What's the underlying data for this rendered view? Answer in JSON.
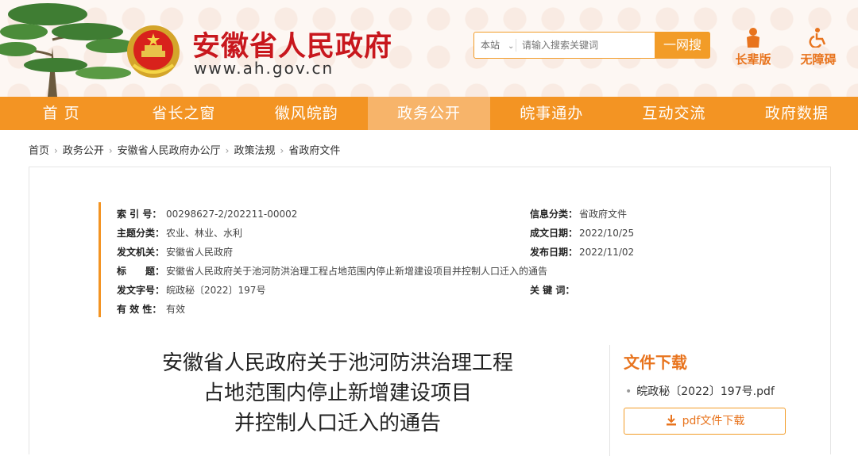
{
  "header": {
    "title": "安徽省人民政府",
    "url": "www.ah.gov.cn",
    "search": {
      "scope": "本站",
      "placeholder": "请输入搜索关键词",
      "button": "一网搜"
    },
    "tools": [
      {
        "label": "长辈版",
        "icon": "elder-icon"
      },
      {
        "label": "无障碍",
        "icon": "accessibility-icon"
      }
    ]
  },
  "nav": {
    "items": [
      "首 页",
      "省长之窗",
      "徽风皖韵",
      "政务公开",
      "皖事通办",
      "互动交流",
      "政府数据"
    ],
    "active_index": 3
  },
  "breadcrumb": [
    "首页",
    "政务公开",
    "安徽省人民政府办公厅",
    "政策法规",
    "省政府文件"
  ],
  "meta": {
    "index_no": {
      "key": "索 引 号：",
      "value": "00298627-2/202211-00002"
    },
    "topic": {
      "key": "主题分类：",
      "value": "农业、林业、水利"
    },
    "issuer": {
      "key": "发文机关：",
      "value": "安徽省人民政府"
    },
    "subject": {
      "key": "标　　题：",
      "value": "安徽省人民政府关于池河防洪治理工程占地范围内停止新增建设项目并控制人口迁入的通告"
    },
    "doc_no": {
      "key": "发文字号：",
      "value": "皖政秘〔2022〕197号"
    },
    "validity": {
      "key": "有 效 性：",
      "value": "有效"
    },
    "info_class": {
      "key": "信息分类：",
      "value": "省政府文件"
    },
    "created": {
      "key": "成文日期：",
      "value": "2022/10/25"
    },
    "published": {
      "key": "发布日期：",
      "value": "2022/11/02"
    },
    "keywords": {
      "key": "关 键 词：",
      "value": ""
    }
  },
  "document": {
    "title_lines": [
      "安徽省人民政府关于池河防洪治理工程",
      "占地范围内停止新增建设项目",
      "并控制人口迁入的通告"
    ]
  },
  "download": {
    "heading": "文件下载",
    "file_name": "皖政秘〔2022〕197号.pdf",
    "button": "pdf文件下载"
  },
  "colors": {
    "brand_red": "#c8171d",
    "nav_orange": "#f39423",
    "accent_orange": "#e8741e"
  }
}
